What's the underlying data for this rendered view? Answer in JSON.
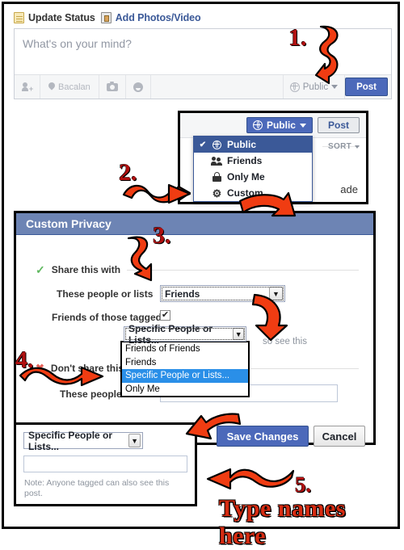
{
  "composer": {
    "header": {
      "update_status": "Update Status",
      "update_status_icon": "note-icon",
      "add_photos": "Add Photos/Video",
      "add_photos_icon": "photo-icon"
    },
    "placeholder": "What's on your mind?",
    "toolbar": {
      "tag_icon": "tag-person-icon",
      "location_icon": "location-pin-icon",
      "location_label": "Bacalan",
      "camera_icon": "camera-icon",
      "emoji_icon": "smiley-icon"
    },
    "privacy_label": "Public",
    "privacy_icon": "globe-icon",
    "post_label": "Post"
  },
  "privacy_popup": {
    "selected_label": "Public",
    "selected_icon": "globe-icon",
    "post_label": "Post",
    "sort_label": "SORT",
    "partial_text": "ade",
    "menu": [
      {
        "label": "Public",
        "icon": "globe-icon",
        "checked": true
      },
      {
        "label": "Friends",
        "icon": "friends-icon",
        "checked": false
      },
      {
        "label": "Only Me",
        "icon": "lock-icon",
        "checked": false
      },
      {
        "label": "Custom",
        "icon": "gear-icon",
        "checked": false
      }
    ]
  },
  "custom_privacy": {
    "title": "Custom Privacy",
    "share_section": {
      "icon": "green-check-icon",
      "label": "Share this with",
      "field_label": "These people or lists",
      "field_value": "Friends",
      "tagged_label": "Friends of those tagged",
      "tagged_checked": true,
      "tagged_checkmark": "✔"
    },
    "dont_share_section": {
      "icon": "red-x-icon",
      "label": "Don't share this",
      "field_label": "These people or",
      "field_value": ""
    },
    "open_select": {
      "value": "Specific People or Lists...",
      "options": [
        "Friends of Friends",
        "Friends",
        "Specific People or Lists...",
        "Only Me"
      ],
      "selected_index": 2
    },
    "side_text": "so see this",
    "buttons": {
      "save": "Save Changes",
      "cancel": "Cancel"
    }
  },
  "bottom_panel": {
    "select_value": "Specific People or Lists...",
    "input_value": "",
    "note": "Note: Anyone tagged can also see this post."
  },
  "annotations": {
    "step1": "1.",
    "step2": "2.",
    "step3": "3.",
    "step4": "4.",
    "step5": "5.",
    "type_names": "Type names here"
  },
  "colors": {
    "fb_blue": "#4c69ba",
    "title_bar": "#6d84b4",
    "menu_highlight": "#3b5998",
    "list_highlight": "#2a8fe8",
    "annotation_red": "#f03c12",
    "annotation_text": "#b01010"
  }
}
